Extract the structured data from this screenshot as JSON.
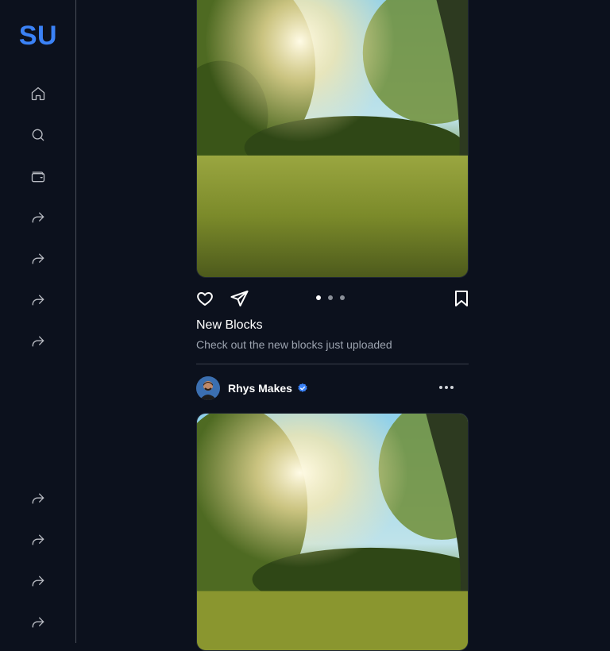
{
  "sidebar": {
    "logo": "SU",
    "items": [
      {
        "icon": "home-icon"
      },
      {
        "icon": "search-icon"
      },
      {
        "icon": "wallet-icon"
      },
      {
        "icon": "share-icon"
      },
      {
        "icon": "share-icon"
      },
      {
        "icon": "share-icon"
      },
      {
        "icon": "share-icon"
      }
    ],
    "bottom_items": [
      {
        "icon": "share-icon"
      },
      {
        "icon": "share-icon"
      },
      {
        "icon": "share-icon"
      },
      {
        "icon": "share-icon"
      }
    ]
  },
  "posts": [
    {
      "image": "meadow-sunlight-photo",
      "actions": [
        "heart-icon",
        "send-icon",
        "bookmark-icon"
      ],
      "carousel": {
        "count": 3,
        "active_index": 0
      },
      "title": "New Blocks",
      "description": "Check out the new blocks just uploaded"
    },
    {
      "author": {
        "name": "Rhys Makes",
        "verified": true
      },
      "image": "meadow-sunlight-photo"
    }
  ],
  "colors": {
    "background": "#0c111d",
    "accent": "#3b82f6",
    "verified_badge": "#3b82f6"
  }
}
